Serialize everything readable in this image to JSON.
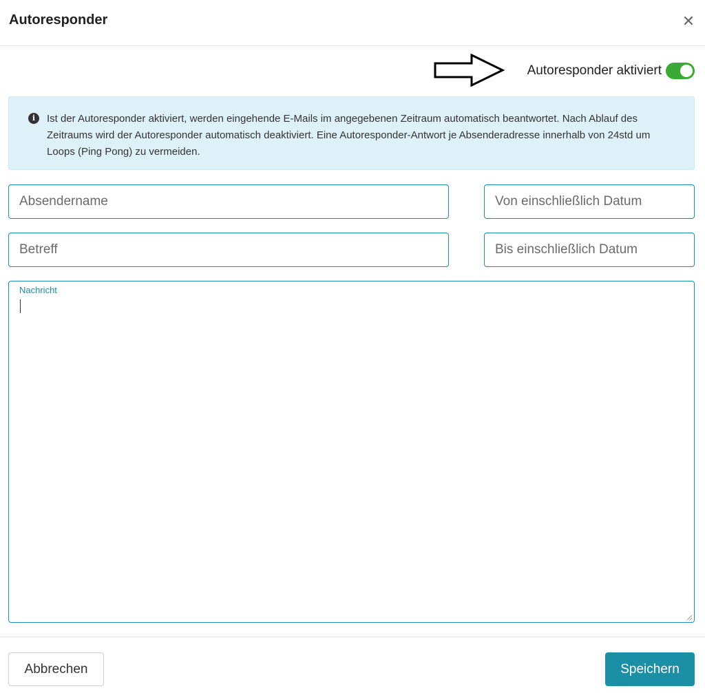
{
  "dialog": {
    "title": "Autoresponder",
    "close_symbol": "✕",
    "close_icon": "close-icon"
  },
  "toggle": {
    "label": "Autoresponder aktiviert",
    "checked": true,
    "on_color": "#3aaa35"
  },
  "annotation": {
    "icon": "arrow-right-icon"
  },
  "info": {
    "icon": "info-circle-icon",
    "icon_glyph": "i",
    "text": "Ist der Autoresponder aktiviert, werden eingehende E-Mails im angegebenen Zeitraum automatisch beantwortet. Nach Ablauf des Zeitraums wird der Autoresponder automatisch deaktiviert. Eine Autoresponder-Antwort je Absenderadresse innerhalb von 24std um Loops (Ping Pong) zu vermeiden.",
    "background_color": "#dff1f8"
  },
  "form": {
    "sender_name": {
      "value": "",
      "placeholder": "Absendername"
    },
    "date_from": {
      "value": "",
      "placeholder": "Von einschließlich Datum"
    },
    "subject": {
      "value": "",
      "placeholder": "Betreff"
    },
    "date_to": {
      "value": "",
      "placeholder": "Bis einschließlich Datum"
    },
    "message": {
      "label": "Nachricht",
      "value": ""
    }
  },
  "footer": {
    "cancel_label": "Abbrechen",
    "save_label": "Speichern"
  },
  "colors": {
    "accent": "#1a8fa6",
    "border": "#1a8fa6"
  }
}
